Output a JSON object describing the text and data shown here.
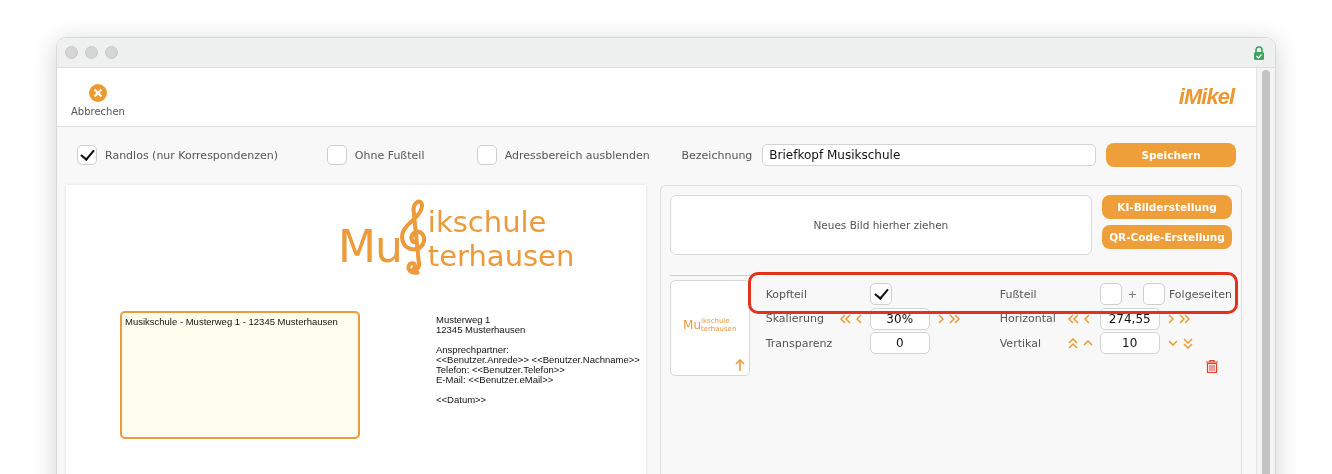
{
  "toolbar": {
    "cancel_label": "Abbrechen",
    "brand": "iMikel"
  },
  "options": [
    {
      "label": "Randlos (nur Korrespondenzen)",
      "checked": true
    },
    {
      "label": "Ohne Fußteil",
      "checked": false
    },
    {
      "label": "Adressbereich ausblenden",
      "checked": false
    }
  ],
  "name_field": {
    "label": "Bezeichnung",
    "value": "Briefkopf Musikschule"
  },
  "save_button": "Speichern",
  "preview": {
    "logo": [
      "Mu",
      "ikschule",
      "terhausen"
    ],
    "sender_line": "Musikschule - Musterweg 1 - 12345 Musterhausen",
    "info_blocks": [
      [
        "Musterweg 1",
        "12345 Musterhausen"
      ],
      [
        "Ansprechpartner:",
        "<<Benutzer.Anrede>> <<Benutzer.Nachname>>",
        "Telefon: <<Benutzer.Telefon>>",
        "E-Mail: <<Benutzer.eMail>>"
      ],
      [
        "<<Datum>>"
      ]
    ]
  },
  "image_panel": {
    "drop_hint": "Neues Bild hierher ziehen",
    "buttons": [
      "KI-Bilderstellung",
      "QR-Code-Erstellung"
    ],
    "thumbnail_logo": [
      "Mu",
      "ikschule",
      "terhausen"
    ]
  },
  "settings": {
    "header": {
      "label": "Kopfteil",
      "checked": true
    },
    "footer": {
      "label": "Fußteil",
      "checked": false,
      "plus": "+",
      "following_checked": false,
      "following_label": "Folgeseiten"
    },
    "scaling": {
      "label": "Skalierung",
      "value": "30%"
    },
    "horizontal": {
      "label": "Horizontal",
      "value": "274,55"
    },
    "transparency": {
      "label": "Transparenz",
      "value": "0"
    },
    "vertical": {
      "label": "Vertikal",
      "value": "10"
    }
  }
}
